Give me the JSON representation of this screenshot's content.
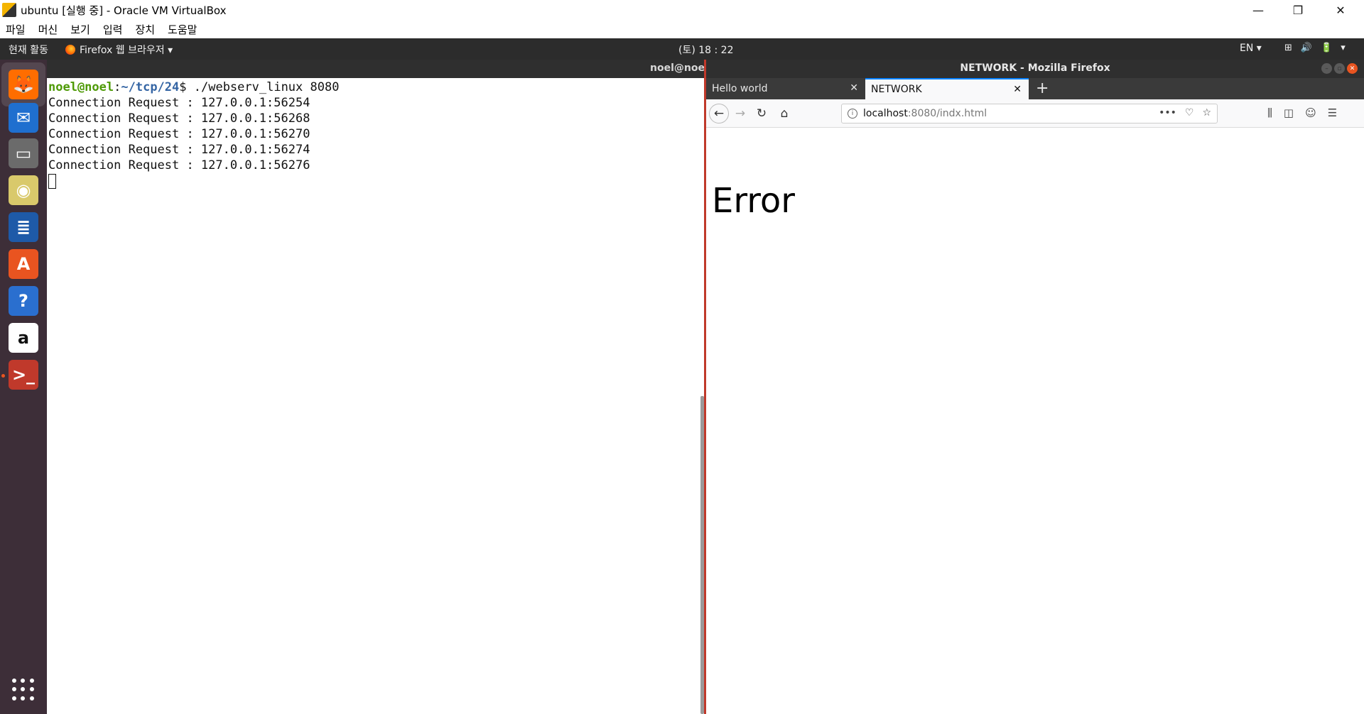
{
  "vbox": {
    "title": "ubuntu [실행 중] - Oracle VM VirtualBox",
    "menu": [
      "파일",
      "머신",
      "보기",
      "입력",
      "장치",
      "도움말"
    ],
    "minimize": "—",
    "restore": "❐",
    "close": "✕"
  },
  "topbar": {
    "activities": "현재 활동",
    "app_menu": "Firefox 웹 브라우저 ▾",
    "clock": "(토) 18 : 22",
    "lang": "EN ▾",
    "tray": [
      "⊞",
      "🔊",
      "🔋",
      "▾"
    ]
  },
  "dock": {
    "items": [
      {
        "name": "firefox-icon",
        "glyph": "🦊",
        "color": "#ff6d00"
      },
      {
        "name": "thunderbird-icon",
        "glyph": "✉",
        "color": "#1f6fcf"
      },
      {
        "name": "files-icon",
        "glyph": "▭",
        "color": "#6b6b6b"
      },
      {
        "name": "rhythmbox-icon",
        "glyph": "◉",
        "color": "#d9c96b"
      },
      {
        "name": "libreoffice-writer-icon",
        "glyph": "≣",
        "color": "#1e5aa8"
      },
      {
        "name": "software-center-icon",
        "glyph": "A",
        "color": "#e95420"
      },
      {
        "name": "help-icon",
        "glyph": "?",
        "color": "#2a6fcf"
      },
      {
        "name": "amazon-icon",
        "glyph": "a",
        "color": "#ffffff"
      },
      {
        "name": "terminal-icon",
        "glyph": ">_",
        "color": "#c0392b"
      }
    ]
  },
  "terminal": {
    "title": "noel@noe",
    "prompt_user": "noel@noel",
    "prompt_colon": ":",
    "prompt_path": "~/tcp/24",
    "prompt_dollar": "$ ",
    "command": "./webserv_linux 8080",
    "lines": [
      "Connection Request : 127.0.0.1:56254",
      "Connection Request : 127.0.0.1:56268",
      "Connection Request : 127.0.0.1:56270",
      "Connection Request : 127.0.0.1:56274",
      "Connection Request : 127.0.0.1:56276"
    ]
  },
  "firefox": {
    "window_title": "NETWORK - Mozilla Firefox",
    "tabs": [
      {
        "label": "Hello world",
        "close": "✕"
      },
      {
        "label": "NETWORK",
        "close": "✕"
      }
    ],
    "new_tab": "+",
    "nav": {
      "back": "←",
      "forward": "→",
      "reload": "↻",
      "home": "⌂"
    },
    "url_host": "localhost",
    "url_rest": ":8080/indx.html",
    "url_info": "i",
    "url_actions": [
      "•••",
      "♡",
      "☆"
    ],
    "toolbar_right": [
      "⫼",
      "◫",
      "☺",
      "☰"
    ],
    "page": {
      "heading": "Error"
    }
  }
}
